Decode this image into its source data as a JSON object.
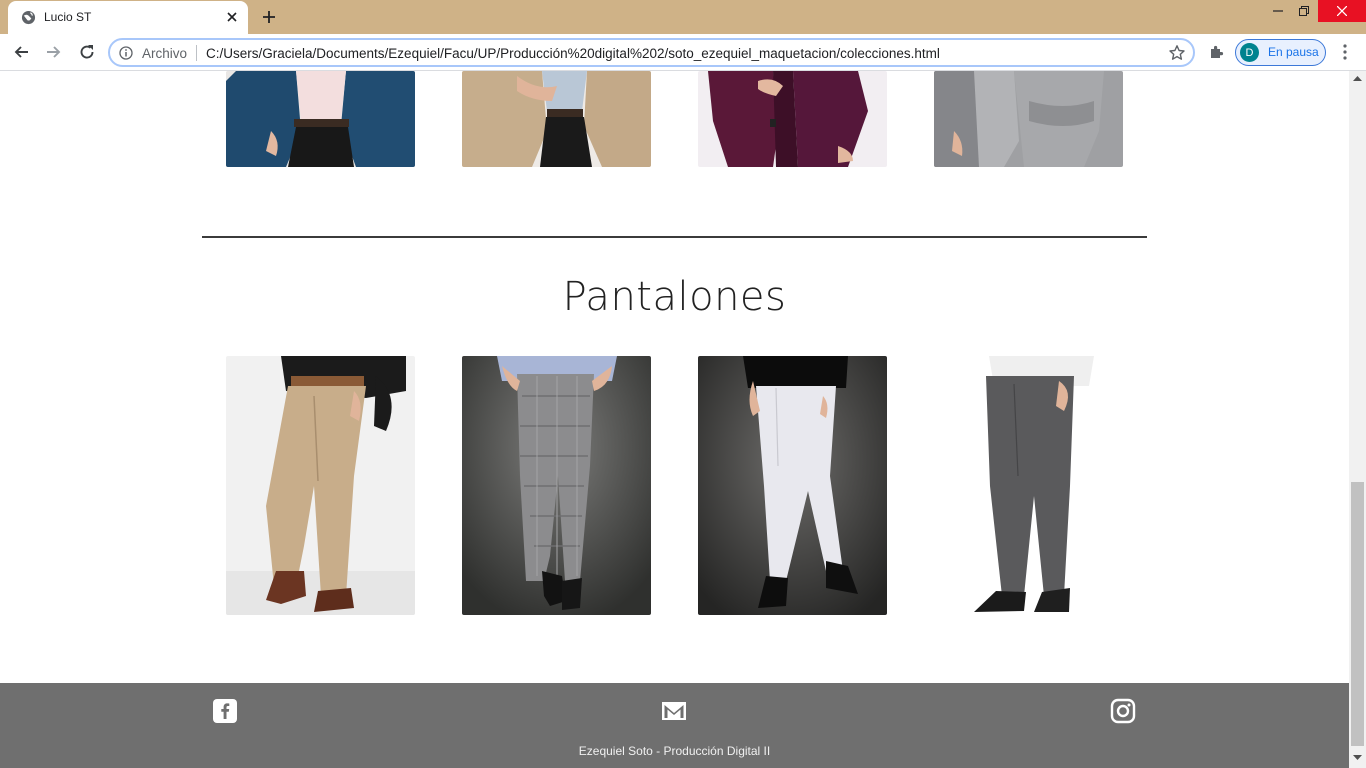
{
  "browser": {
    "tab_title": "Lucio ST",
    "omnibox_label": "Archivo",
    "url": "C:/Users/Graciela/Documents/Ezequiel/Facu/UP/Producción%20digital%202/soto_ezequiel_maquetacion/colecciones.html",
    "profile_initial": "D",
    "profile_status": "En pausa",
    "titlebar_color": "#cfb287"
  },
  "page": {
    "section_title": "Pantalones",
    "top_row_products": [
      {
        "name": "Saco azul",
        "color": "#1f4a6e"
      },
      {
        "name": "Saco beige",
        "color": "#c6ad8c"
      },
      {
        "name": "Saco bordó",
        "color": "#5a1838"
      },
      {
        "name": "Saco gris",
        "color": "#9a9a9c"
      }
    ],
    "pants_products": [
      {
        "name": "Pantalón beige",
        "color": "#c8ad8a"
      },
      {
        "name": "Pantalón gris cuadrillé",
        "color": "#8c8c8e"
      },
      {
        "name": "Pantalón blanco",
        "color": "#e8e8ee"
      },
      {
        "name": "Pantalón gris oscuro",
        "color": "#5a5a5c"
      }
    ],
    "footer_text": "Ezequiel Soto - Producción Digital II",
    "footer_color": "#6f6f6f"
  },
  "icons": [
    "globe-icon",
    "close-icon",
    "plus-icon",
    "back-icon",
    "forward-icon",
    "reload-icon",
    "info-icon",
    "star-icon",
    "puzzle-icon",
    "kebab-menu-icon",
    "facebook-icon",
    "mail-icon",
    "instagram-icon"
  ]
}
